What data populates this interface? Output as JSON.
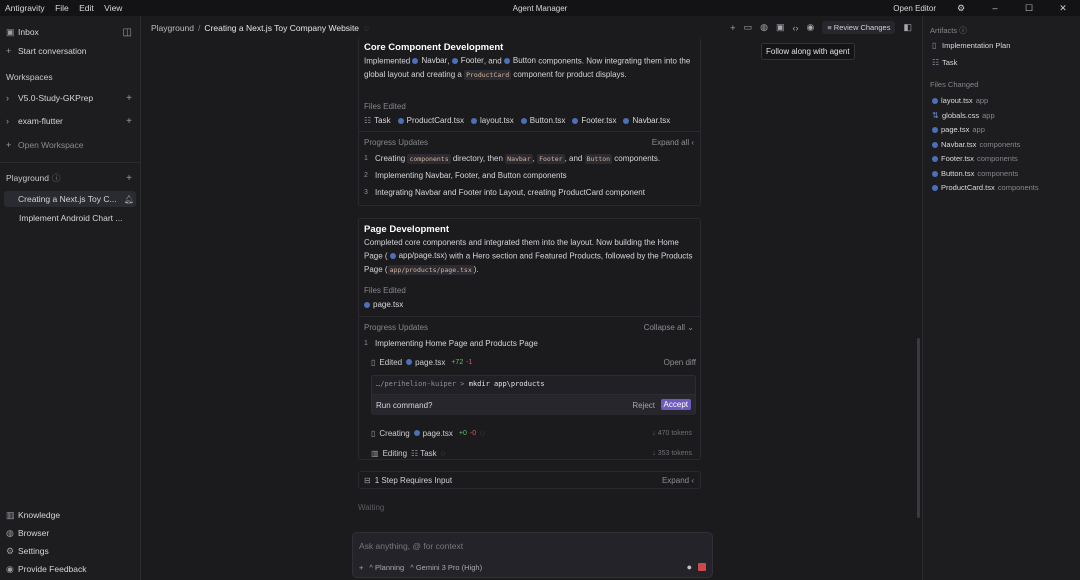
{
  "app": {
    "name": "Antigravity",
    "menu": [
      "File",
      "Edit",
      "View"
    ],
    "window_title": "Agent Manager",
    "open_editor": "Open Editor"
  },
  "sidebar": {
    "inbox": "Inbox",
    "start": "Start conversation",
    "workspaces_header": "Workspaces",
    "workspaces": [
      "V5.0-Study-GKPrep",
      "exam-flutter"
    ],
    "open_workspace": "Open Workspace",
    "playground_header": "Playground",
    "conversations": [
      "Creating a Next.js Toy C...",
      "Implement Android Chart ..."
    ],
    "bottom": [
      "Knowledge",
      "Browser",
      "Settings",
      "Provide Feedback"
    ]
  },
  "breadcrumb": {
    "root": "Playground",
    "current": "Creating a Next.js Toy Company Website"
  },
  "toolbar": {
    "review": "Review Changes",
    "tooltip": "Follow along with agent"
  },
  "card1": {
    "title": "Core Component Development",
    "body": [
      "Implemented ",
      "Navbar",
      ", ",
      "Footer",
      ", and ",
      "Button",
      " components. Now integrating them into the global layout and creating a ",
      "ProductCard",
      " component for product displays."
    ],
    "files_label": "Files Edited",
    "files": [
      "Task",
      "ProductCard.tsx",
      "layout.tsx",
      "Button.tsx",
      "Footer.tsx",
      "Navbar.tsx"
    ],
    "progress_label": "Progress Updates",
    "expand": "Expand all",
    "steps": [
      {
        "n": "1",
        "parts": [
          "Creating ",
          "components",
          " directory, then ",
          "Navbar",
          ", ",
          "Footer",
          ", and ",
          "Button",
          " components."
        ]
      },
      {
        "n": "2",
        "text": "Implementing Navbar, Footer, and Button components"
      },
      {
        "n": "3",
        "text": "Integrating Navbar and Footer into Layout, creating ProductCard component"
      }
    ]
  },
  "card2": {
    "title": "Page Development",
    "body": [
      "Completed core components and integrated them into the layout. Now building the Home Page (",
      "app/page.tsx",
      ") with a Hero section and Featured Products, followed by the Products Page (",
      "app/products/page.tsx",
      ")."
    ],
    "files_label": "Files Edited",
    "files": [
      "page.tsx"
    ],
    "progress_label": "Progress Updates",
    "collapse": "Collapse all",
    "step1": {
      "n": "1",
      "text": "Implementing Home Page and Products Page"
    },
    "edited": {
      "label": "Edited",
      "file": "page.tsx",
      "add": "+72",
      "del": "-1",
      "open": "Open diff"
    },
    "cmd": {
      "path": "…/perihelion-kuiper",
      ">": ">",
      "command": "mkdir app\\products",
      "question": "Run command?",
      "reject": "Reject",
      "accept": "Accept"
    },
    "creating": {
      "label": "Creating",
      "file": "page.tsx",
      "add": "+0",
      "del": "-0",
      "tokens": "↓ 470 tokens"
    },
    "editing": {
      "label": "Editing",
      "file": "Task",
      "tokens": "↓ 353 tokens"
    }
  },
  "step_input": {
    "text": "1 Step Requires Input",
    "expand": "Expand"
  },
  "waiting": "Waiting",
  "input": {
    "placeholder": "Ask anything, @ for context",
    "mode": "Planning",
    "model": "Gemini 3 Pro (High)"
  },
  "right": {
    "artifacts_header": "Artifacts",
    "artifacts": [
      "Implementation Plan",
      "Task"
    ],
    "files_header": "Files Changed",
    "files": [
      {
        "name": "layout.tsx",
        "dir": "app"
      },
      {
        "name": "globals.css",
        "dir": "app"
      },
      {
        "name": "page.tsx",
        "dir": "app"
      },
      {
        "name": "Navbar.tsx",
        "dir": "components"
      },
      {
        "name": "Footer.tsx",
        "dir": "components"
      },
      {
        "name": "Button.tsx",
        "dir": "components"
      },
      {
        "name": "ProductCard.tsx",
        "dir": "components"
      }
    ]
  },
  "colors": {
    "bg": "#1b1b1e",
    "accent": "#6e5bbd",
    "file_dot": "#4b6fb8",
    "added": "#5fbf6a",
    "removed": "#d65e5e"
  }
}
